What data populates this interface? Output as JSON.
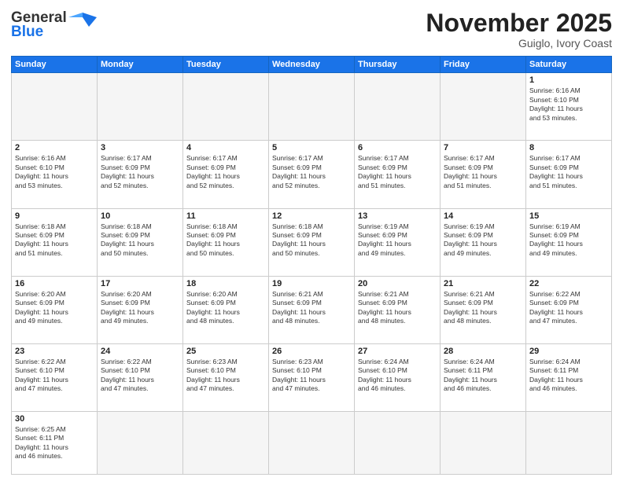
{
  "header": {
    "logo_general": "General",
    "logo_blue": "Blue",
    "month_title": "November 2025",
    "subtitle": "Guiglo, Ivory Coast"
  },
  "days_of_week": [
    "Sunday",
    "Monday",
    "Tuesday",
    "Wednesday",
    "Thursday",
    "Friday",
    "Saturday"
  ],
  "weeks": [
    [
      {
        "day": "",
        "info": ""
      },
      {
        "day": "",
        "info": ""
      },
      {
        "day": "",
        "info": ""
      },
      {
        "day": "",
        "info": ""
      },
      {
        "day": "",
        "info": ""
      },
      {
        "day": "",
        "info": ""
      },
      {
        "day": "1",
        "info": "Sunrise: 6:16 AM\nSunset: 6:10 PM\nDaylight: 11 hours\nand 53 minutes."
      }
    ],
    [
      {
        "day": "2",
        "info": "Sunrise: 6:16 AM\nSunset: 6:10 PM\nDaylight: 11 hours\nand 53 minutes."
      },
      {
        "day": "3",
        "info": "Sunrise: 6:17 AM\nSunset: 6:09 PM\nDaylight: 11 hours\nand 52 minutes."
      },
      {
        "day": "4",
        "info": "Sunrise: 6:17 AM\nSunset: 6:09 PM\nDaylight: 11 hours\nand 52 minutes."
      },
      {
        "day": "5",
        "info": "Sunrise: 6:17 AM\nSunset: 6:09 PM\nDaylight: 11 hours\nand 52 minutes."
      },
      {
        "day": "6",
        "info": "Sunrise: 6:17 AM\nSunset: 6:09 PM\nDaylight: 11 hours\nand 51 minutes."
      },
      {
        "day": "7",
        "info": "Sunrise: 6:17 AM\nSunset: 6:09 PM\nDaylight: 11 hours\nand 51 minutes."
      },
      {
        "day": "8",
        "info": "Sunrise: 6:17 AM\nSunset: 6:09 PM\nDaylight: 11 hours\nand 51 minutes."
      }
    ],
    [
      {
        "day": "9",
        "info": "Sunrise: 6:18 AM\nSunset: 6:09 PM\nDaylight: 11 hours\nand 51 minutes."
      },
      {
        "day": "10",
        "info": "Sunrise: 6:18 AM\nSunset: 6:09 PM\nDaylight: 11 hours\nand 50 minutes."
      },
      {
        "day": "11",
        "info": "Sunrise: 6:18 AM\nSunset: 6:09 PM\nDaylight: 11 hours\nand 50 minutes."
      },
      {
        "day": "12",
        "info": "Sunrise: 6:18 AM\nSunset: 6:09 PM\nDaylight: 11 hours\nand 50 minutes."
      },
      {
        "day": "13",
        "info": "Sunrise: 6:19 AM\nSunset: 6:09 PM\nDaylight: 11 hours\nand 49 minutes."
      },
      {
        "day": "14",
        "info": "Sunrise: 6:19 AM\nSunset: 6:09 PM\nDaylight: 11 hours\nand 49 minutes."
      },
      {
        "day": "15",
        "info": "Sunrise: 6:19 AM\nSunset: 6:09 PM\nDaylight: 11 hours\nand 49 minutes."
      }
    ],
    [
      {
        "day": "16",
        "info": "Sunrise: 6:20 AM\nSunset: 6:09 PM\nDaylight: 11 hours\nand 49 minutes."
      },
      {
        "day": "17",
        "info": "Sunrise: 6:20 AM\nSunset: 6:09 PM\nDaylight: 11 hours\nand 49 minutes."
      },
      {
        "day": "18",
        "info": "Sunrise: 6:20 AM\nSunset: 6:09 PM\nDaylight: 11 hours\nand 48 minutes."
      },
      {
        "day": "19",
        "info": "Sunrise: 6:21 AM\nSunset: 6:09 PM\nDaylight: 11 hours\nand 48 minutes."
      },
      {
        "day": "20",
        "info": "Sunrise: 6:21 AM\nSunset: 6:09 PM\nDaylight: 11 hours\nand 48 minutes."
      },
      {
        "day": "21",
        "info": "Sunrise: 6:21 AM\nSunset: 6:09 PM\nDaylight: 11 hours\nand 48 minutes."
      },
      {
        "day": "22",
        "info": "Sunrise: 6:22 AM\nSunset: 6:09 PM\nDaylight: 11 hours\nand 47 minutes."
      }
    ],
    [
      {
        "day": "23",
        "info": "Sunrise: 6:22 AM\nSunset: 6:10 PM\nDaylight: 11 hours\nand 47 minutes."
      },
      {
        "day": "24",
        "info": "Sunrise: 6:22 AM\nSunset: 6:10 PM\nDaylight: 11 hours\nand 47 minutes."
      },
      {
        "day": "25",
        "info": "Sunrise: 6:23 AM\nSunset: 6:10 PM\nDaylight: 11 hours\nand 47 minutes."
      },
      {
        "day": "26",
        "info": "Sunrise: 6:23 AM\nSunset: 6:10 PM\nDaylight: 11 hours\nand 47 minutes."
      },
      {
        "day": "27",
        "info": "Sunrise: 6:24 AM\nSunset: 6:10 PM\nDaylight: 11 hours\nand 46 minutes."
      },
      {
        "day": "28",
        "info": "Sunrise: 6:24 AM\nSunset: 6:11 PM\nDaylight: 11 hours\nand 46 minutes."
      },
      {
        "day": "29",
        "info": "Sunrise: 6:24 AM\nSunset: 6:11 PM\nDaylight: 11 hours\nand 46 minutes."
      }
    ],
    [
      {
        "day": "30",
        "info": "Sunrise: 6:25 AM\nSunset: 6:11 PM\nDaylight: 11 hours\nand 46 minutes."
      },
      {
        "day": "",
        "info": ""
      },
      {
        "day": "",
        "info": ""
      },
      {
        "day": "",
        "info": ""
      },
      {
        "day": "",
        "info": ""
      },
      {
        "day": "",
        "info": ""
      },
      {
        "day": "",
        "info": ""
      }
    ]
  ]
}
